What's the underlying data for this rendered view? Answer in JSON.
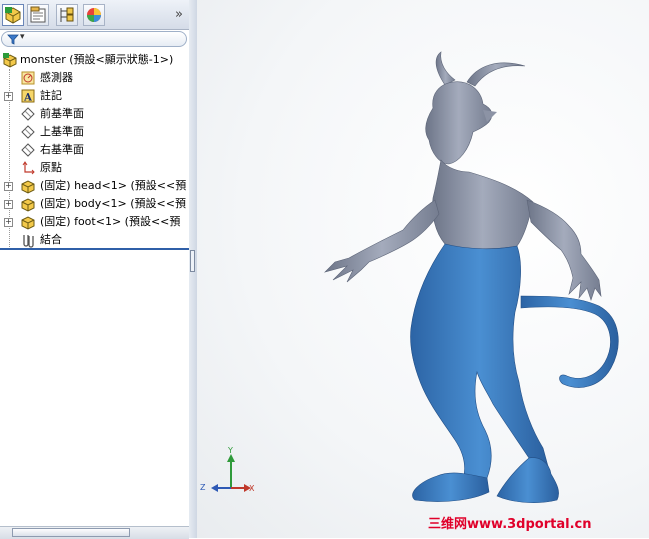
{
  "panel": {
    "tabs": [
      {
        "name": "featuremanager-tab-icon"
      },
      {
        "name": "propertymanager-tab-icon"
      },
      {
        "name": "configurationmanager-tab-icon"
      },
      {
        "name": "displaymanager-tab-icon"
      }
    ],
    "more_glyph": "»",
    "filter_glyph": "▾"
  },
  "tree": {
    "root": "monster  (預設<顯示狀態-1>)",
    "items": [
      {
        "label": "感測器",
        "icon": "sensor-icon"
      },
      {
        "label": "註記",
        "icon": "annotation-icon"
      },
      {
        "label": "前基準面",
        "icon": "plane-icon"
      },
      {
        "label": "上基準面",
        "icon": "plane-icon"
      },
      {
        "label": "右基準面",
        "icon": "plane-icon"
      },
      {
        "label": "原點",
        "icon": "origin-icon"
      },
      {
        "label": "(固定) head<1> (預設<<預",
        "icon": "part-icon"
      },
      {
        "label": "(固定) body<1> (預設<<預",
        "icon": "part-icon"
      },
      {
        "label": "(固定) foot<1> (預設<<預",
        "icon": "part-icon"
      },
      {
        "label": "結合",
        "icon": "mates-icon"
      }
    ]
  },
  "triad": {
    "x": "X",
    "y": "Y",
    "z": "Z"
  },
  "watermark": "三维网www.3dportal.cn",
  "colors": {
    "body_gray": "#8e96a8",
    "pants_blue": "#3d7ec2",
    "selection": "#2f5fa8"
  }
}
